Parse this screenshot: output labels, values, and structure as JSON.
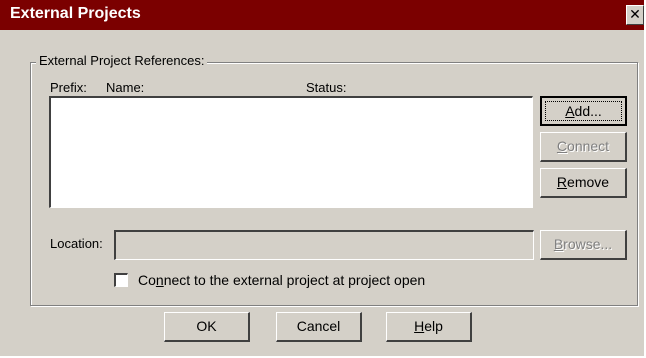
{
  "window": {
    "title": "External Projects",
    "close_glyph": "✕"
  },
  "group": {
    "label": "External Project References:",
    "columns": {
      "prefix": "Prefix:",
      "name": "Name:",
      "status": "Status:"
    },
    "items": []
  },
  "buttons": {
    "add": {
      "pre": "",
      "key": "A",
      "post": "dd..."
    },
    "connect": {
      "pre": "",
      "key": "C",
      "post": "onnect"
    },
    "remove": {
      "pre": "",
      "key": "R",
      "post": "emove"
    },
    "browse": {
      "pre": "",
      "key": "B",
      "post": "rowse..."
    },
    "ok": "OK",
    "cancel": "Cancel",
    "help": {
      "pre": "",
      "key": "H",
      "post": "elp"
    }
  },
  "location": {
    "label": "Location:",
    "value": ""
  },
  "connect_option": {
    "pre": "Co",
    "key": "n",
    "post": "nect to the external project at project open",
    "checked": false
  },
  "colors": {
    "titlebar": "#7b0000",
    "face": "#d4d0c8"
  }
}
